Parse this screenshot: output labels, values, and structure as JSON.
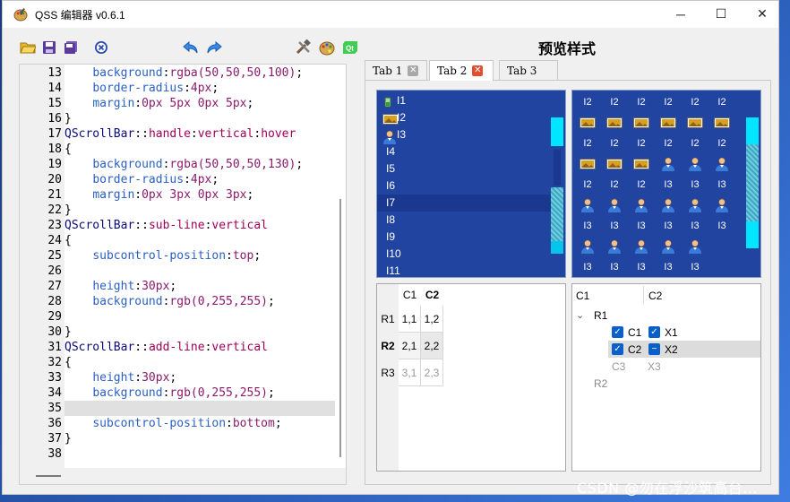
{
  "window": {
    "title": "QSS 编辑器 v0.6.1",
    "controls": {
      "minimize": "─",
      "maximize": "☐",
      "close": "✕"
    }
  },
  "toolbar": {
    "buttons": [
      "open-folder-icon",
      "save-icon",
      "save-as-icon",
      "close-file-icon",
      "undo-icon",
      "redo-icon",
      "tools-icon",
      "palette-icon",
      "qt-icon"
    ]
  },
  "preview": {
    "title": "预览样式"
  },
  "editor": {
    "current_line": "35",
    "lines": [
      {
        "num": "13",
        "tokens": [
          {
            "t": "    "
          },
          {
            "t": "background",
            "c": "prop"
          },
          {
            "t": ":",
            "c": "punc"
          },
          {
            "t": "rgba(50,50,50,100)",
            "c": "val"
          },
          {
            "t": ";",
            "c": "punc"
          }
        ]
      },
      {
        "num": "14",
        "tokens": [
          {
            "t": "    "
          },
          {
            "t": "border-radius",
            "c": "prop"
          },
          {
            "t": ":",
            "c": "punc"
          },
          {
            "t": "4px",
            "c": "val"
          },
          {
            "t": ";",
            "c": "punc"
          }
        ]
      },
      {
        "num": "15",
        "tokens": [
          {
            "t": "    "
          },
          {
            "t": "margin",
            "c": "prop"
          },
          {
            "t": ":",
            "c": "punc"
          },
          {
            "t": "0px 5px 0px 5px",
            "c": "val"
          },
          {
            "t": ";",
            "c": "punc"
          }
        ]
      },
      {
        "num": "16",
        "tokens": [
          {
            "t": "}",
            "c": "brace"
          }
        ]
      },
      {
        "num": "17",
        "tokens": [
          {
            "t": "QScrollBar",
            "c": "sel"
          },
          {
            "t": "::",
            "c": "punc"
          },
          {
            "t": "handle",
            "c": "pseudo"
          },
          {
            "t": ":",
            "c": "punc"
          },
          {
            "t": "vertical",
            "c": "pseudo"
          },
          {
            "t": ":",
            "c": "punc"
          },
          {
            "t": "hover",
            "c": "pseudo"
          }
        ]
      },
      {
        "num": "18",
        "tokens": [
          {
            "t": "{",
            "c": "brace"
          }
        ]
      },
      {
        "num": "19",
        "tokens": [
          {
            "t": "    "
          },
          {
            "t": "background",
            "c": "prop"
          },
          {
            "t": ":",
            "c": "punc"
          },
          {
            "t": "rgba(50,50,50,130)",
            "c": "val"
          },
          {
            "t": ";",
            "c": "punc"
          }
        ]
      },
      {
        "num": "20",
        "tokens": [
          {
            "t": "    "
          },
          {
            "t": "border-radius",
            "c": "prop"
          },
          {
            "t": ":",
            "c": "punc"
          },
          {
            "t": "4px",
            "c": "val"
          },
          {
            "t": ";",
            "c": "punc"
          }
        ]
      },
      {
        "num": "21",
        "tokens": [
          {
            "t": "    "
          },
          {
            "t": "margin",
            "c": "prop"
          },
          {
            "t": ":",
            "c": "punc"
          },
          {
            "t": "0px 3px 0px 3px",
            "c": "val"
          },
          {
            "t": ";",
            "c": "punc"
          }
        ]
      },
      {
        "num": "22",
        "tokens": [
          {
            "t": "}",
            "c": "brace"
          }
        ]
      },
      {
        "num": "23",
        "tokens": [
          {
            "t": "QScrollBar",
            "c": "sel"
          },
          {
            "t": "::",
            "c": "punc"
          },
          {
            "t": "sub-line",
            "c": "pseudo"
          },
          {
            "t": ":",
            "c": "punc"
          },
          {
            "t": "vertical",
            "c": "pseudo"
          }
        ]
      },
      {
        "num": "24",
        "tokens": [
          {
            "t": "{",
            "c": "brace"
          }
        ]
      },
      {
        "num": "25",
        "tokens": [
          {
            "t": "    "
          },
          {
            "t": "subcontrol-position",
            "c": "prop"
          },
          {
            "t": ":",
            "c": "punc"
          },
          {
            "t": "top",
            "c": "val"
          },
          {
            "t": ";",
            "c": "punc"
          }
        ]
      },
      {
        "num": "26",
        "tokens": []
      },
      {
        "num": "27",
        "tokens": [
          {
            "t": "    "
          },
          {
            "t": "height",
            "c": "prop"
          },
          {
            "t": ":",
            "c": "punc"
          },
          {
            "t": "30px",
            "c": "val"
          },
          {
            "t": ";",
            "c": "punc"
          }
        ]
      },
      {
        "num": "28",
        "tokens": [
          {
            "t": "    "
          },
          {
            "t": "background",
            "c": "prop"
          },
          {
            "t": ":",
            "c": "punc"
          },
          {
            "t": "rgb(0,255,255)",
            "c": "val"
          },
          {
            "t": ";",
            "c": "punc"
          }
        ]
      },
      {
        "num": "29",
        "tokens": []
      },
      {
        "num": "30",
        "tokens": [
          {
            "t": "}",
            "c": "brace"
          }
        ]
      },
      {
        "num": "31",
        "tokens": [
          {
            "t": "QScrollBar",
            "c": "sel"
          },
          {
            "t": "::",
            "c": "punc"
          },
          {
            "t": "add-line",
            "c": "pseudo"
          },
          {
            "t": ":",
            "c": "punc"
          },
          {
            "t": "vertical",
            "c": "pseudo"
          }
        ]
      },
      {
        "num": "32",
        "tokens": [
          {
            "t": "{",
            "c": "brace"
          }
        ]
      },
      {
        "num": "33",
        "tokens": [
          {
            "t": "    "
          },
          {
            "t": "height",
            "c": "prop"
          },
          {
            "t": ":",
            "c": "punc"
          },
          {
            "t": "30px",
            "c": "val"
          },
          {
            "t": ";",
            "c": "punc"
          }
        ]
      },
      {
        "num": "34",
        "tokens": [
          {
            "t": "    "
          },
          {
            "t": "background",
            "c": "prop"
          },
          {
            "t": ":",
            "c": "punc"
          },
          {
            "t": "rgb(0,255,255)",
            "c": "val"
          },
          {
            "t": ";",
            "c": "punc"
          }
        ]
      },
      {
        "num": "35",
        "tokens": []
      },
      {
        "num": "36",
        "tokens": [
          {
            "t": "    "
          },
          {
            "t": "subcontrol-position",
            "c": "prop"
          },
          {
            "t": ":",
            "c": "punc"
          },
          {
            "t": "bottom",
            "c": "val"
          },
          {
            "t": ";",
            "c": "punc"
          }
        ]
      },
      {
        "num": "37",
        "tokens": [
          {
            "t": "}",
            "c": "brace"
          }
        ]
      },
      {
        "num": "38",
        "tokens": []
      }
    ]
  },
  "tabs": [
    {
      "label": "Tab 1",
      "close": "✕"
    },
    {
      "label": "Tab 2",
      "close": "✕",
      "active": true
    },
    {
      "label": "Tab 3",
      "close": "✕"
    }
  ],
  "list_view": {
    "items": [
      {
        "label": "I1",
        "icon": "battery-icon"
      },
      {
        "label": "I2",
        "icon": "picture-icon"
      },
      {
        "label": "I3",
        "icon": "user-icon"
      },
      {
        "label": "I4"
      },
      {
        "label": "I5"
      },
      {
        "label": "I6"
      },
      {
        "label": "I7",
        "selected": true
      },
      {
        "label": "I8"
      },
      {
        "label": "I9"
      },
      {
        "label": "I10"
      },
      {
        "label": "I11"
      }
    ]
  },
  "icon_view": {
    "rows": [
      [
        "I2",
        "I2",
        "I2",
        "I2",
        "I2",
        "I2"
      ],
      [
        "picture-icon",
        "picture-icon",
        "picture-icon",
        "picture-icon",
        "picture-icon",
        "picture-icon"
      ],
      [
        "I2",
        "I2",
        "I2",
        "I2",
        "I2",
        "I2"
      ],
      [
        "picture-icon",
        "picture-icon",
        "picture-icon",
        "user-icon",
        "user-icon",
        "user-icon"
      ],
      [
        "I2",
        "I2",
        "I2",
        "I3",
        "I3",
        "I3"
      ],
      [
        "user-icon",
        "user-icon",
        "user-icon",
        "user-icon",
        "user-icon",
        "user-icon"
      ],
      [
        "I3",
        "I3",
        "I3",
        "I3",
        "I3",
        "I3"
      ],
      [
        "user-icon",
        "user-icon",
        "user-icon",
        "user-icon",
        "user-icon",
        ""
      ],
      [
        "I3",
        "I3",
        "I3",
        "I3",
        "I3",
        ""
      ]
    ]
  },
  "table_view": {
    "col_headers": [
      "C1",
      "C2"
    ],
    "row_headers": [
      "R1",
      "R2",
      "R3"
    ],
    "sort_indicator": "^",
    "cells": [
      [
        "1,1",
        "1,2"
      ],
      [
        "2,1",
        "2,2"
      ],
      [
        "3,1",
        "2,3"
      ]
    ]
  },
  "tree_view": {
    "headers": [
      "C1",
      "C2"
    ],
    "expand_arrow": "⌄",
    "root": "R1",
    "children": [
      {
        "c1": "C1",
        "c2": "X1",
        "c1_state": "checked",
        "c2_state": "checked"
      },
      {
        "c1": "C2",
        "c2": "X2",
        "c1_state": "checked",
        "c2_state": "partial",
        "selected": true
      },
      {
        "c1": "C3",
        "c2": "X3",
        "disabled": true
      }
    ],
    "root2": "R2"
  },
  "watermark": "CSDN @勿在浮沙筑高台..."
}
